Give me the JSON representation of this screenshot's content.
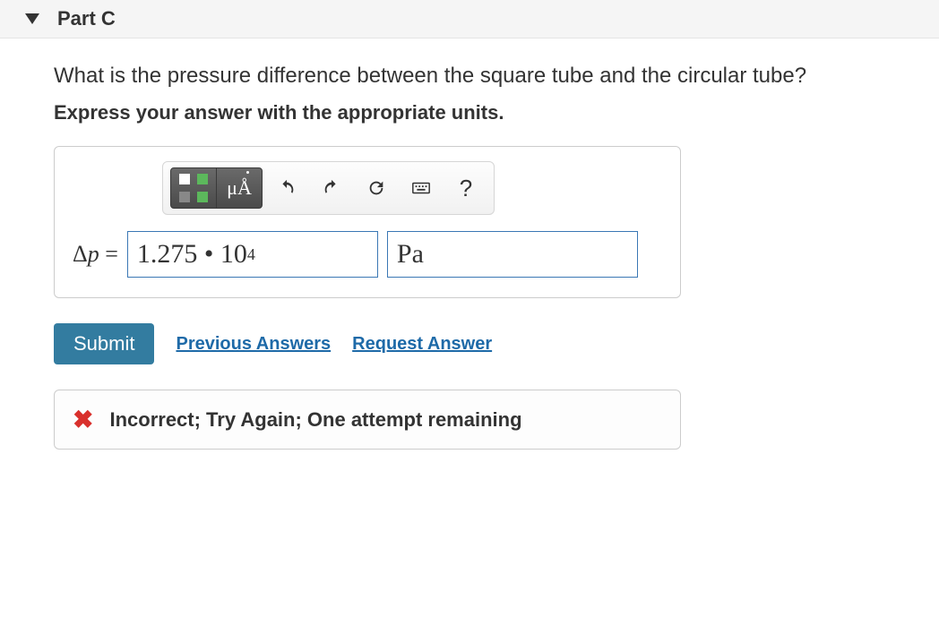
{
  "part": {
    "label": "Part C"
  },
  "question": "What is the pressure difference between the square tube and the circular tube?",
  "instruction": "Express your answer with the appropriate units.",
  "toolbar": {
    "templates_label": "templates",
    "symbols_label": "μÅ",
    "help_label": "?"
  },
  "answer": {
    "variable_delta": "Δ",
    "variable_p": "p",
    "equals": " = ",
    "value_display": "1.275 • 10",
    "value_exponent": "4",
    "units": "Pa"
  },
  "actions": {
    "submit": "Submit",
    "previous_answers": "Previous Answers",
    "request_answer": "Request Answer"
  },
  "feedback": {
    "icon": "✖",
    "message": "Incorrect; Try Again; One attempt remaining"
  }
}
